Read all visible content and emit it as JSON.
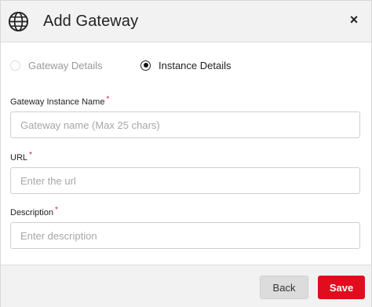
{
  "dialog": {
    "title": "Add Gateway",
    "title_icon": "globe-icon",
    "close_label": "×"
  },
  "steps": [
    {
      "label": "Gateway Details",
      "selected": false,
      "disabled": true
    },
    {
      "label": "Instance Details",
      "selected": true,
      "disabled": false
    }
  ],
  "form": {
    "instance_name": {
      "label": "Gateway Instance Name",
      "required_mark": "*",
      "value": "",
      "placeholder": "Gateway name (Max 25 chars)"
    },
    "url": {
      "label": "URL",
      "required_mark": "*",
      "value": "",
      "placeholder": "Enter the url"
    },
    "description": {
      "label": "Description",
      "required_mark": "*",
      "value": "",
      "placeholder": "Enter description"
    }
  },
  "footer": {
    "back_label": "Back",
    "save_label": "Save"
  },
  "colors": {
    "accent": "#e10d1e",
    "header_bg": "#f2f2f2",
    "required": "#e11d2b"
  }
}
